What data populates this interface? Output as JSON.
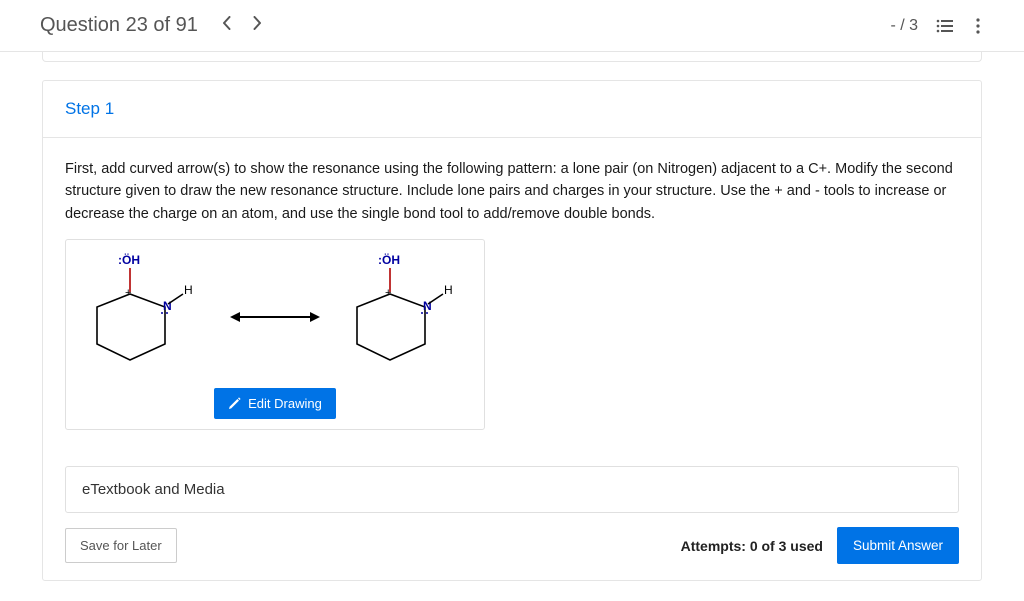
{
  "header": {
    "question_label": "Question 23 of 91",
    "score": "- / 3"
  },
  "step": {
    "title": "Step 1",
    "instructions": "First, add curved arrow(s) to show the resonance using the following pattern: a lone pair (on Nitrogen) adjacent to a C+. Modify the second structure given to draw the new resonance structure. Include lone pairs and charges in your structure. Use the + and - tools to increase or decrease the charge on an atom, and use the single bond tool to add/remove double bonds."
  },
  "drawing": {
    "edit_label": "Edit Drawing",
    "label_oh": ":ÖH",
    "label_h": "H",
    "label_n": "N"
  },
  "etextbook": {
    "label": "eTextbook and Media"
  },
  "footer": {
    "save_label": "Save for Later",
    "attempts_label": "Attempts: 0 of 3 used",
    "submit_label": "Submit Answer"
  }
}
